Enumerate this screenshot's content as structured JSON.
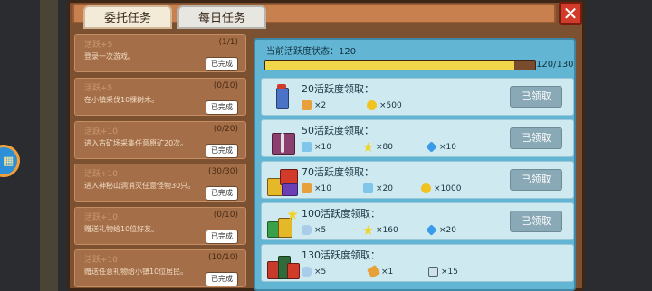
{
  "tabs": [
    {
      "label": "委托任务"
    },
    {
      "label": "每日任务"
    }
  ],
  "close_label": "✕",
  "tasks": [
    {
      "title": "活跃+5",
      "progress": "(1/1)",
      "desc": "登录一次游戏。",
      "done": "已完成"
    },
    {
      "title": "活跃+5",
      "progress": "(0/10)",
      "desc": "在小镇采伐10棵树木。",
      "done": "已完成"
    },
    {
      "title": "活跃+10",
      "progress": "(0/20)",
      "desc": "进入古矿场采集任意原矿20次。",
      "done": "已完成"
    },
    {
      "title": "活跃+10",
      "progress": "(30/30)",
      "desc": "进入神秘山洞消灭任意怪物30只。",
      "done": "已完成"
    },
    {
      "title": "活跃+10",
      "progress": "(0/10)",
      "desc": "赠送礼物给10位好友。",
      "done": "已完成"
    },
    {
      "title": "活跃+10",
      "progress": "(10/10)",
      "desc": "赠送任意礼物给小镇10位居民。",
      "done": "已完成"
    }
  ],
  "activity": {
    "label": "当前活跃度状态：120",
    "progress_text": "120/130",
    "fraction": 0.923
  },
  "rewards": [
    {
      "title": "20活跃度领取：",
      "items": [
        {
          "icon": "potion-icon",
          "text": "×2"
        },
        {
          "icon": "gold-coin-icon",
          "text": "×500"
        }
      ],
      "button": "已领取"
    },
    {
      "title": "50活跃度领取：",
      "items": [
        {
          "icon": "bottle-icon",
          "text": "×10"
        },
        {
          "icon": "star-icon",
          "text": "×80"
        },
        {
          "icon": "blue-gem-icon",
          "text": "×10"
        }
      ],
      "button": "已领取"
    },
    {
      "title": "70活跃度领取：",
      "items": [
        {
          "icon": "potion-icon",
          "text": "×10"
        },
        {
          "icon": "bottle-icon",
          "text": "×20"
        },
        {
          "icon": "gold-coin-icon",
          "text": "×1000"
        }
      ],
      "button": "已领取"
    },
    {
      "title": "100活跃度领取：",
      "items": [
        {
          "icon": "blue-bag-icon",
          "text": "×5"
        },
        {
          "icon": "star-icon",
          "text": "×160"
        },
        {
          "icon": "blue-gem-icon",
          "text": "×20"
        }
      ],
      "button": "已领取"
    },
    {
      "title": "130活跃度领取：",
      "items": [
        {
          "icon": "blue-bag-icon",
          "text": "×5"
        },
        {
          "icon": "scroll-icon",
          "text": "×1"
        },
        {
          "icon": "ticket-icon",
          "text": "×15"
        }
      ],
      "button": ""
    }
  ],
  "colors": {
    "accent_yellow": "#f1d64a",
    "panel_brown": "#7c5132",
    "reward_bg": "#cfe9f1",
    "claim_btn": "#8aa9b6"
  }
}
